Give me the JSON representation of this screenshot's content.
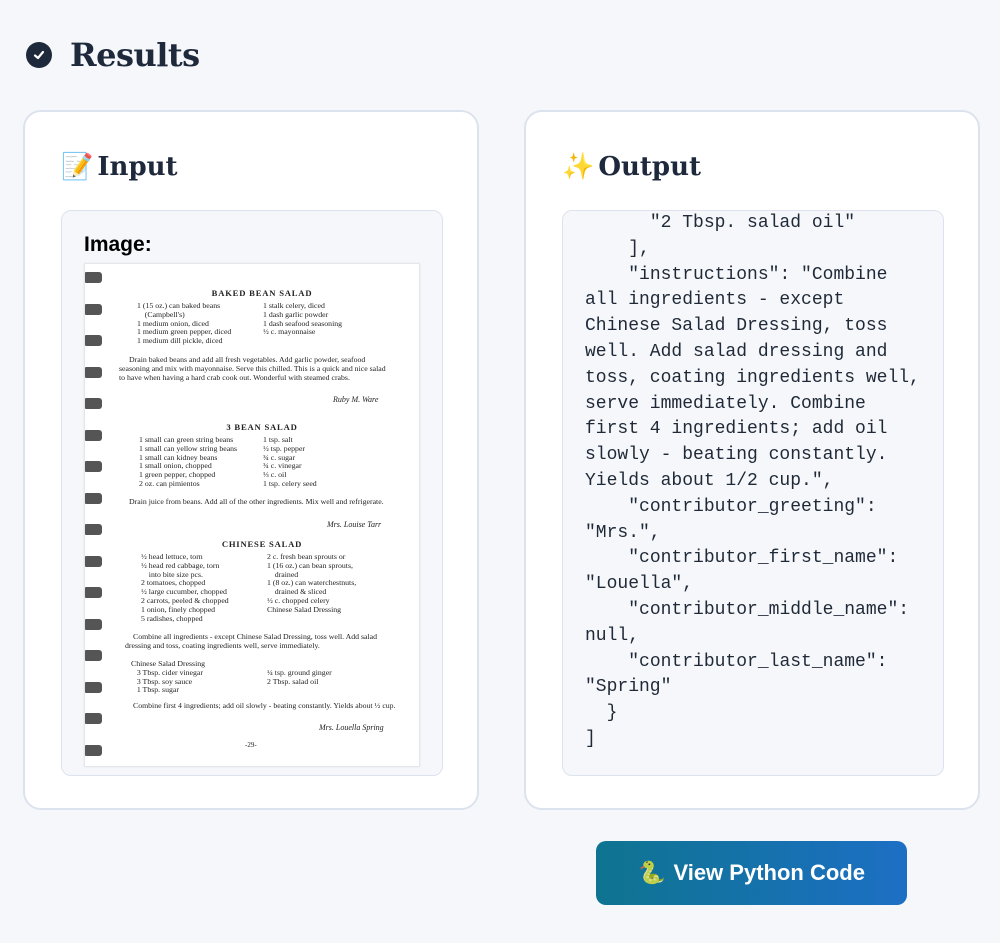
{
  "header": {
    "title": "Results",
    "icon": "check-circle-icon"
  },
  "input_card": {
    "emoji": "📝",
    "title": "Input",
    "image_label": "Image:"
  },
  "output_card": {
    "emoji": "✨",
    "title": "Output",
    "code": "      \"2 Tbsp. salad oil\"\n    ],\n    \"instructions\": \"Combine all ingredients - except Chinese Salad Dressing, toss well. Add salad dressing and toss, coating ingredients well, serve immediately. Combine first 4 ingredients; add oil slowly - beating constantly. Yields about 1/2 cup.\",\n    \"contributor_greeting\": \"Mrs.\",\n    \"contributor_first_name\": \"Louella\",\n    \"contributor_middle_name\": null,\n    \"contributor_last_name\": \"Spring\"\n  }\n]"
  },
  "button": {
    "emoji": "🐍",
    "label": "View Python Code"
  },
  "document": {
    "r1_title": "BAKED BEAN SALAD",
    "r1_left": "1 (15 oz.) can baked beans\n    (Campbell's)\n1 medium onion, diced\n1 medium green pepper, diced\n1 medium dill pickle, diced",
    "r1_right": "1 stalk celery, diced\n1 dash garlic powder\n1 dash seafood seasoning\n½ c. mayonnaise",
    "r1_para": "Drain baked beans and add all fresh vegetables. Add garlic powder, seafood seasoning and mix with mayonnaise. Serve this chilled. This is a quick and nice salad to have when having a hard crab cook out. Wonderful with steamed crabs.",
    "r1_sig": "Ruby M. Ware",
    "r2_title": "3 BEAN SALAD",
    "r2_left": "1 small can green string beans\n1 small can yellow string beans\n1 small can kidney beans\n1 small onion, chopped\n1 green pepper, chopped\n2 oz. can pimientos",
    "r2_right": "1 tsp. salt\n½ tsp. pepper\n¾ c. sugar\n¾ c. vinegar\n⅓ c. oil\n1 tsp. celery seed",
    "r2_para": "Drain juice from beans. Add all of the other ingredients. Mix well and refrigerate.",
    "r2_sig": "Mrs. Louise Tarr",
    "r3_title": "CHINESE SALAD",
    "r3_left": "½ head lettuce, torn\n½ head red cabbage, torn\n    into bite size pcs.\n2 tomatoes, chopped\n½ large cucumber, chopped\n2 carrots, peeled & chopped\n1 onion, finely chopped\n5 radishes, chopped",
    "r3_right": "2 c. fresh bean sprouts or\n1 (16 oz.) can bean sprouts,\n    drained\n1 (8 oz.) can waterchestnuts,\n    drained & sliced\n½ c. chopped celery\nChinese Salad Dressing",
    "r3_para": "Combine all ingredients - except Chinese Salad Dressing, toss well. Add salad dressing and toss, coating ingredients well, serve immediately.",
    "dressing_left": "Chinese Salad Dressing\n   3 Tbsp. cider vinegar\n   3 Tbsp. soy sauce\n   1 Tbsp. sugar",
    "dressing_right": "¼ tsp. ground ginger\n2 Tbsp. salad oil",
    "r3_para2": "Combine first 4 ingredients; add oil slowly - beating constantly. Yields about ½ cup.",
    "r3_sig": "Mrs. Louella Spring",
    "page_number": "-29-"
  }
}
